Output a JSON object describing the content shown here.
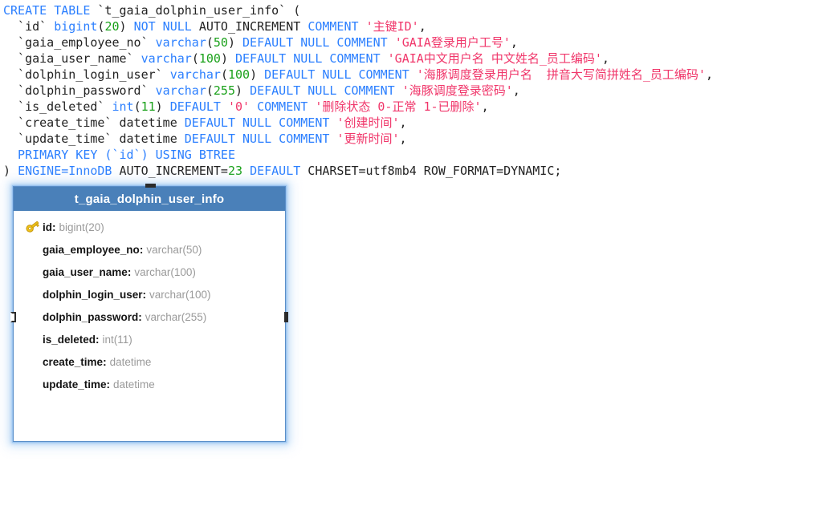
{
  "sql": {
    "language": "mysql-ddl",
    "lines": [
      [
        {
          "t": "CREATE TABLE ",
          "c": "kw"
        },
        {
          "t": "`t_gaia_dolphin_user_info` (",
          "c": "plain"
        }
      ],
      [
        {
          "t": "  `id` ",
          "c": "plain"
        },
        {
          "t": "bigint",
          "c": "kw2"
        },
        {
          "t": "(",
          "c": "plain"
        },
        {
          "t": "20",
          "c": "num"
        },
        {
          "t": ") ",
          "c": "plain"
        },
        {
          "t": "NOT NULL",
          "c": "kw"
        },
        {
          "t": " AUTO_INCREMENT ",
          "c": "plain"
        },
        {
          "t": "COMMENT",
          "c": "kw"
        },
        {
          "t": " ",
          "c": "plain"
        },
        {
          "t": "'主键ID'",
          "c": "str"
        },
        {
          "t": ",",
          "c": "plain"
        }
      ],
      [
        {
          "t": "  `gaia_employee_no` ",
          "c": "plain"
        },
        {
          "t": "varchar",
          "c": "kw2"
        },
        {
          "t": "(",
          "c": "plain"
        },
        {
          "t": "50",
          "c": "num"
        },
        {
          "t": ") ",
          "c": "plain"
        },
        {
          "t": "DEFAULT NULL COMMENT",
          "c": "kw"
        },
        {
          "t": " ",
          "c": "plain"
        },
        {
          "t": "'GAIA登录用户工号'",
          "c": "str"
        },
        {
          "t": ",",
          "c": "plain"
        }
      ],
      [
        {
          "t": "  `gaia_user_name` ",
          "c": "plain"
        },
        {
          "t": "varchar",
          "c": "kw2"
        },
        {
          "t": "(",
          "c": "plain"
        },
        {
          "t": "100",
          "c": "num"
        },
        {
          "t": ") ",
          "c": "plain"
        },
        {
          "t": "DEFAULT NULL COMMENT",
          "c": "kw"
        },
        {
          "t": " ",
          "c": "plain"
        },
        {
          "t": "'GAIA中文用户名 中文姓名_员工编码'",
          "c": "str"
        },
        {
          "t": ",",
          "c": "plain"
        }
      ],
      [
        {
          "t": "  `dolphin_login_user` ",
          "c": "plain"
        },
        {
          "t": "varchar",
          "c": "kw2"
        },
        {
          "t": "(",
          "c": "plain"
        },
        {
          "t": "100",
          "c": "num"
        },
        {
          "t": ") ",
          "c": "plain"
        },
        {
          "t": "DEFAULT NULL COMMENT",
          "c": "kw"
        },
        {
          "t": " ",
          "c": "plain"
        },
        {
          "t": "'海豚调度登录用户名  拼音大写简拼姓名_员工编码'",
          "c": "str"
        },
        {
          "t": ",",
          "c": "plain"
        }
      ],
      [
        {
          "t": "  `dolphin_password` ",
          "c": "plain"
        },
        {
          "t": "varchar",
          "c": "kw2"
        },
        {
          "t": "(",
          "c": "plain"
        },
        {
          "t": "255",
          "c": "num"
        },
        {
          "t": ") ",
          "c": "plain"
        },
        {
          "t": "DEFAULT NULL COMMENT",
          "c": "kw"
        },
        {
          "t": " ",
          "c": "plain"
        },
        {
          "t": "'海豚调度登录密码'",
          "c": "str"
        },
        {
          "t": ",",
          "c": "plain"
        }
      ],
      [
        {
          "t": "  `is_deleted` ",
          "c": "plain"
        },
        {
          "t": "int",
          "c": "kw2"
        },
        {
          "t": "(",
          "c": "plain"
        },
        {
          "t": "11",
          "c": "num"
        },
        {
          "t": ") ",
          "c": "plain"
        },
        {
          "t": "DEFAULT",
          "c": "kw"
        },
        {
          "t": " ",
          "c": "plain"
        },
        {
          "t": "'0'",
          "c": "str"
        },
        {
          "t": " ",
          "c": "plain"
        },
        {
          "t": "COMMENT",
          "c": "kw"
        },
        {
          "t": " ",
          "c": "plain"
        },
        {
          "t": "'删除状态 0-正常 1-已删除'",
          "c": "str"
        },
        {
          "t": ",",
          "c": "plain"
        }
      ],
      [
        {
          "t": "  `create_time` ",
          "c": "plain"
        },
        {
          "t": "datetime ",
          "c": "plain"
        },
        {
          "t": "DEFAULT NULL COMMENT",
          "c": "kw"
        },
        {
          "t": " ",
          "c": "plain"
        },
        {
          "t": "'创建时间'",
          "c": "str"
        },
        {
          "t": ",",
          "c": "plain"
        }
      ],
      [
        {
          "t": "  `update_time` ",
          "c": "plain"
        },
        {
          "t": "datetime ",
          "c": "plain"
        },
        {
          "t": "DEFAULT NULL COMMENT",
          "c": "kw"
        },
        {
          "t": " ",
          "c": "plain"
        },
        {
          "t": "'更新时间'",
          "c": "str"
        },
        {
          "t": ",",
          "c": "plain"
        }
      ],
      [
        {
          "t": "  PRIMARY KEY (`id`) USING BTREE",
          "c": "kw"
        }
      ],
      [
        {
          "t": ") ",
          "c": "plain"
        },
        {
          "t": "ENGINE=InnoDB",
          "c": "kw"
        },
        {
          "t": " AUTO_INCREMENT=",
          "c": "plain"
        },
        {
          "t": "23",
          "c": "num"
        },
        {
          "t": " ",
          "c": "plain"
        },
        {
          "t": "DEFAULT",
          "c": "kw"
        },
        {
          "t": " CHARSET=utf8mb4 ROW_FORMAT=DYNAMIC;",
          "c": "plain"
        }
      ]
    ]
  },
  "entity": {
    "title": "t_gaia_dolphin_user_info",
    "header_color": "#4a80b9",
    "border_color": "#5b8fc9",
    "type_color": "#9a9a9a",
    "fields": [
      {
        "name": "id",
        "type": "bigint(20)",
        "icon": "primary-key-icon",
        "is_primary": true
      },
      {
        "name": "gaia_employee_no",
        "type": "varchar(50)",
        "icon": "",
        "is_primary": false
      },
      {
        "name": "gaia_user_name",
        "type": "varchar(100)",
        "icon": "",
        "is_primary": false
      },
      {
        "name": "dolphin_login_user",
        "type": "varchar(100)",
        "icon": "",
        "is_primary": false
      },
      {
        "name": "dolphin_password",
        "type": "varchar(255)",
        "icon": "",
        "is_primary": false
      },
      {
        "name": "is_deleted",
        "type": "int(11)",
        "icon": "",
        "is_primary": false
      },
      {
        "name": "create_time",
        "type": "datetime",
        "icon": "",
        "is_primary": false
      },
      {
        "name": "update_time",
        "type": "datetime",
        "icon": "",
        "is_primary": false
      }
    ],
    "separator": ":",
    "handles": [
      "connector-handle-top",
      "connector-handle-left",
      "connector-handle-right"
    ]
  }
}
